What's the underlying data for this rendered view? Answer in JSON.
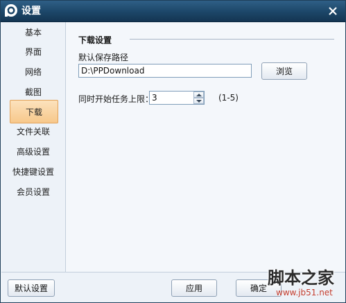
{
  "window": {
    "title": "设置",
    "title_bar_color": "#1c4668"
  },
  "sidebar": {
    "items": [
      {
        "label": "基本",
        "active": false
      },
      {
        "label": "界面",
        "active": false
      },
      {
        "label": "网络",
        "active": false
      },
      {
        "label": "截图",
        "active": false
      },
      {
        "label": "下载",
        "active": true
      },
      {
        "label": "文件关联",
        "active": false
      },
      {
        "label": "高级设置",
        "active": false
      },
      {
        "label": "快捷键设置",
        "active": false
      },
      {
        "label": "会员设置",
        "active": false
      }
    ],
    "active_color": "#f7c88b"
  },
  "download": {
    "section_title": "下载设置",
    "path_label": "默认保存路径",
    "path_value": "D:\\PPDownload",
    "browse_label": "浏览",
    "task_limit_label": "同时开始任务上限：",
    "task_limit_value": "3",
    "task_limit_range": "(1-5)"
  },
  "footer": {
    "default_label": "默认设置",
    "apply_label": "应用",
    "ok_label": "确定"
  },
  "watermark": {
    "main": "脚本之家",
    "sub": "www.jb51.net"
  },
  "icons": {
    "app_logo": "pplive-logo-icon",
    "close": "close-icon"
  }
}
